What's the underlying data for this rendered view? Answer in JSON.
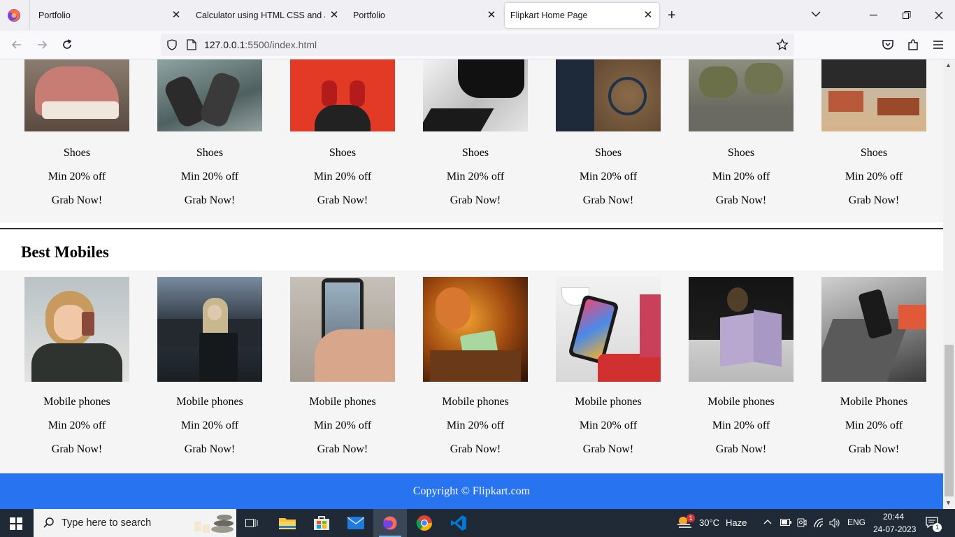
{
  "browser": {
    "tabs": [
      {
        "label": "Portfolio",
        "closable": true
      },
      {
        "label": "Calculator using HTML CSS and JS",
        "closable": true
      },
      {
        "label": "Portfolio",
        "closable": true
      },
      {
        "label": "Flipkart Home Page",
        "closable": true,
        "active": true
      }
    ],
    "url_host": "127.0.0.1",
    "url_rest": ":5500/index.html"
  },
  "page": {
    "shoes_section": {
      "cards": [
        {
          "name": "Shoes",
          "offer": "Min 20% off",
          "cta": "Grab Now!"
        },
        {
          "name": "Shoes",
          "offer": "Min 20% off",
          "cta": "Grab Now!"
        },
        {
          "name": "Shoes",
          "offer": "Min 20% off",
          "cta": "Grab Now!"
        },
        {
          "name": "Shoes",
          "offer": "Min 20% off",
          "cta": "Grab Now!"
        },
        {
          "name": "Shoes",
          "offer": "Min 20% off",
          "cta": "Grab Now!"
        },
        {
          "name": "Shoes",
          "offer": "Min 20% off",
          "cta": "Grab Now!"
        },
        {
          "name": "Shoes",
          "offer": "Min 20% off",
          "cta": "Grab Now!"
        }
      ]
    },
    "mobiles_section": {
      "title": "Best Mobiles",
      "cards": [
        {
          "name": "Mobile phones",
          "offer": "Min 20% off",
          "cta": "Grab Now!"
        },
        {
          "name": "Mobile phones",
          "offer": "Min 20% off",
          "cta": "Grab Now!"
        },
        {
          "name": "Mobile phones",
          "offer": "Min 20% off",
          "cta": "Grab Now!"
        },
        {
          "name": "Mobile phones",
          "offer": "Min 20% off",
          "cta": "Grab Now!"
        },
        {
          "name": "Mobile phones",
          "offer": "Min 20% off",
          "cta": "Grab Now!"
        },
        {
          "name": "Mobile phones",
          "offer": "Min 20% off",
          "cta": "Grab Now!"
        },
        {
          "name": "Mobile Phones",
          "offer": "Min 20% off",
          "cta": "Grab Now!"
        }
      ]
    },
    "footer": "Copyright © Flipkart.com"
  },
  "taskbar": {
    "search_placeholder": "Type here to search",
    "weather_temp": "30°C",
    "weather_desc": "Haze",
    "weather_badge": "1",
    "language": "ENG",
    "time": "20:44",
    "date": "24-07-2023",
    "notification_count": "1"
  },
  "colors": {
    "footer_bg": "#2874f0",
    "taskbar_bg": "#1f2a36"
  }
}
